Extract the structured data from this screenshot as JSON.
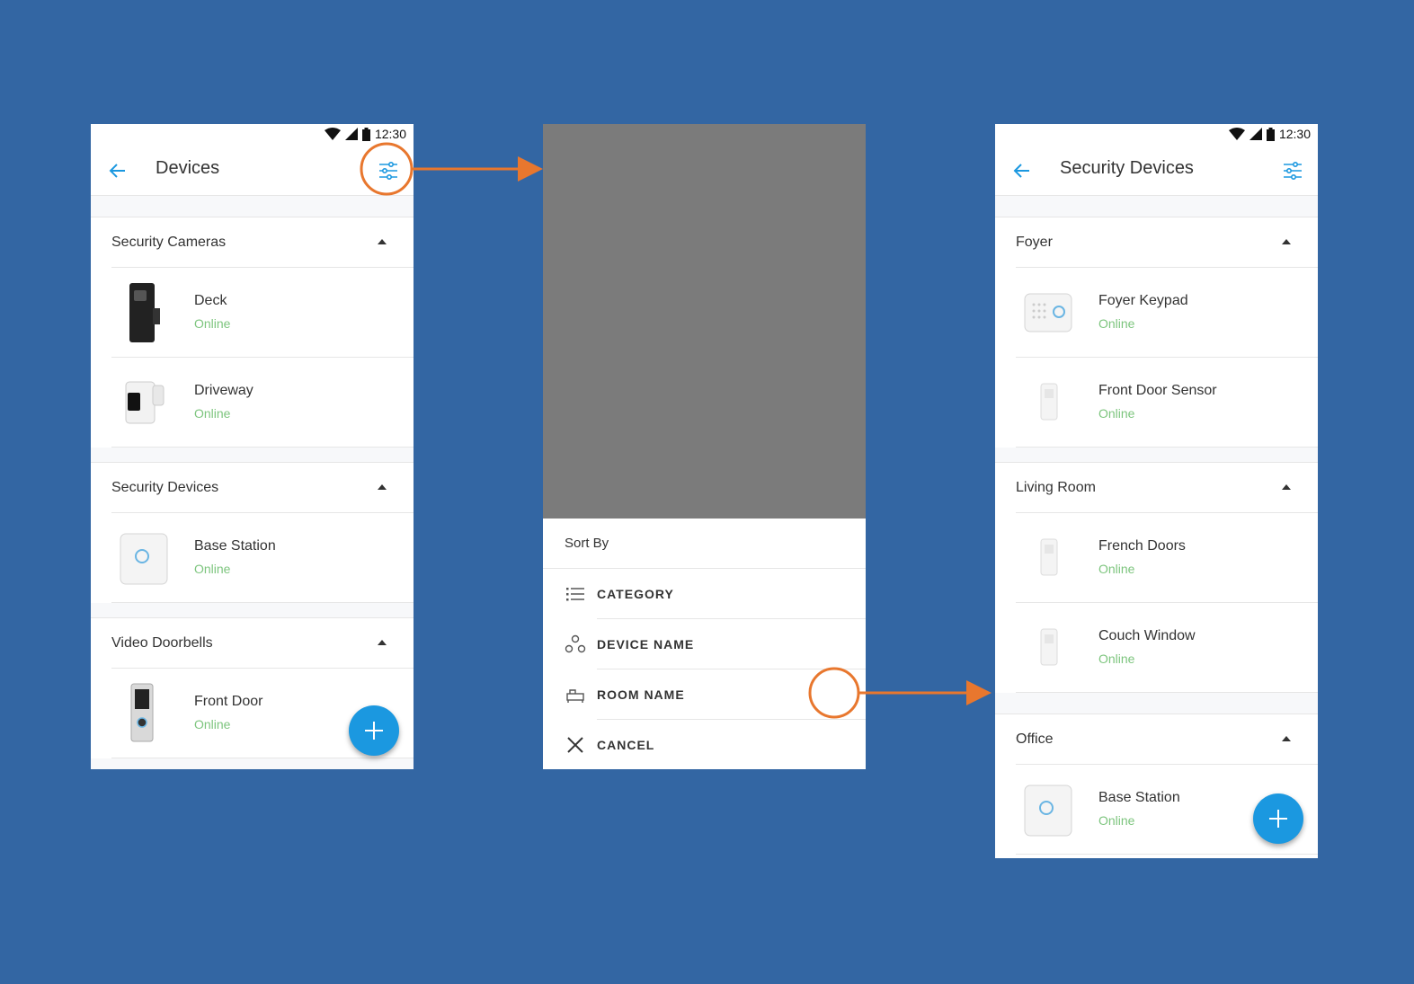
{
  "left_screen": {
    "time": "12:30",
    "title": "Devices",
    "sections": [
      {
        "label": "Security Cameras",
        "devices": [
          {
            "name": "Deck",
            "status": "Online"
          },
          {
            "name": "Driveway",
            "status": "Online"
          }
        ]
      },
      {
        "label": "Security Devices",
        "devices": [
          {
            "name": "Base Station",
            "status": "Online"
          }
        ]
      },
      {
        "label": "Video Doorbells",
        "devices": [
          {
            "name": "Front Door",
            "status": "Online"
          }
        ]
      }
    ]
  },
  "sort_sheet": {
    "title": "Sort By",
    "options": [
      {
        "label": "CATEGORY",
        "icon": "list-icon"
      },
      {
        "label": "DEVICE NAME",
        "icon": "circles-icon"
      },
      {
        "label": "ROOM NAME",
        "icon": "room-icon"
      },
      {
        "label": "CANCEL",
        "icon": "close-icon"
      }
    ]
  },
  "right_screen": {
    "time": "12:30",
    "title": "Security Devices",
    "sections": [
      {
        "label": "Foyer",
        "devices": [
          {
            "name": "Foyer Keypad",
            "status": "Online"
          },
          {
            "name": "Front Door Sensor",
            "status": "Online"
          }
        ]
      },
      {
        "label": "Living Room",
        "devices": [
          {
            "name": "French Doors",
            "status": "Online"
          },
          {
            "name": "Couch Window",
            "status": "Online"
          }
        ]
      },
      {
        "label": "Office",
        "devices": [
          {
            "name": "Base Station",
            "status": "Online"
          }
        ]
      }
    ]
  },
  "colors": {
    "background": "#3366a3",
    "accent": "#1b98e0",
    "online": "#7dc57e",
    "highlight": "#e8772e",
    "scrim": "#7b7b7b"
  }
}
